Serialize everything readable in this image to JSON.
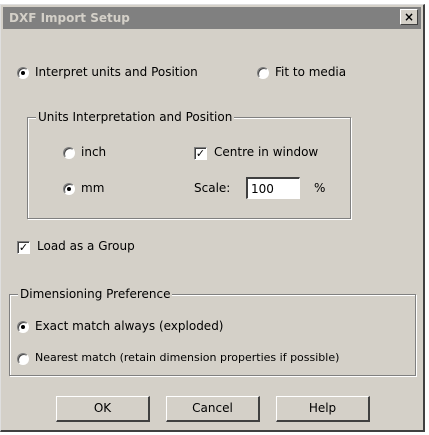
{
  "window": {
    "title": "DXF Import Setup",
    "close_glyph": "×"
  },
  "mode": {
    "interpret_label": "Interpret units and Position",
    "fit_label": "Fit to media",
    "selected": "interpret"
  },
  "units_group": {
    "legend": "Units Interpretation and Position",
    "inch_label": "inch",
    "mm_label": "mm",
    "selected_unit": "mm",
    "centre_label": "Centre in window",
    "centre_checked": true,
    "scale_label": "Scale:",
    "scale_value": "100",
    "scale_unit": "%"
  },
  "load_group": {
    "label": "Load as a Group",
    "checked": true
  },
  "dimensioning": {
    "legend": "Dimensioning Preference",
    "exact_label": "Exact match always (exploded)",
    "nearest_label": "Nearest match (retain dimension properties if possible)",
    "selected": "exact"
  },
  "buttons": {
    "ok": "OK",
    "cancel": "Cancel",
    "help": "Help"
  },
  "colors": {
    "face": "#d4d0c8",
    "titlebar": "#808080",
    "title_text": "#d4d0c8"
  }
}
